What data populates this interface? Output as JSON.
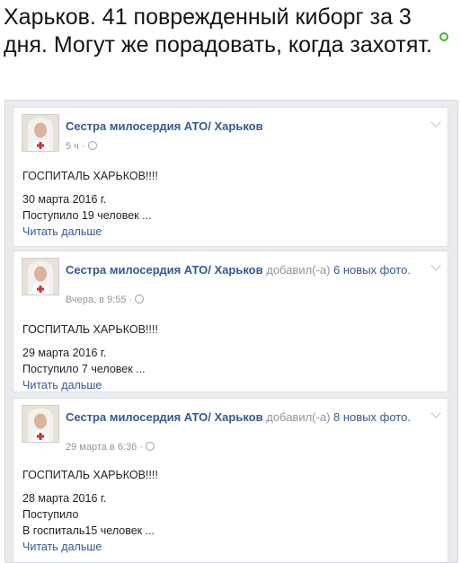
{
  "headline": "Харьков. 41 поврежденный киборг за 3 дня. Могут же порадовать, когда захотят.",
  "posts": [
    {
      "author": "Сестра милосердия АТО/ Харьков",
      "action": "",
      "action_link": "",
      "meta": "5 ч ·",
      "title": "ГОСПИТАЛЬ ХАРЬКОВ!!!!",
      "date": "30 марта 2016 г.",
      "lines": [
        "Поступило 19 человек ..."
      ],
      "more": "Читать дальше"
    },
    {
      "author": "Сестра милосердия АТО/ Харьков",
      "action": "добавил(-а)",
      "action_link": "6 новых фото.",
      "meta": "Вчера, в 9:55 ·",
      "title": "ГОСПИТАЛЬ ХАРЬКОВ!!!!",
      "date": "29 марта 2016 г.",
      "lines": [
        "Поступило 7 человек ..."
      ],
      "more": "Читать дальше"
    },
    {
      "author": "Сестра милосердия АТО/ Харьков",
      "action": "добавил(-а)",
      "action_link": "8 новых фото.",
      "meta": "29 марта в 6:36 ·",
      "title": "ГОСПИТАЛЬ ХАРЬКОВ!!!!",
      "date": "28 марта 2016 г.",
      "lines": [
        "Поступило",
        "В госпиталь15 человек ..."
      ],
      "more": "Читать дальше"
    }
  ],
  "icons": {
    "online": "online-status-icon",
    "globe": "globe-icon",
    "chevron": "chevron-down-icon"
  },
  "colors": {
    "link": "#365899",
    "meta": "#90949c",
    "online": "#42b72a",
    "feed_bg": "#e9ebee"
  }
}
